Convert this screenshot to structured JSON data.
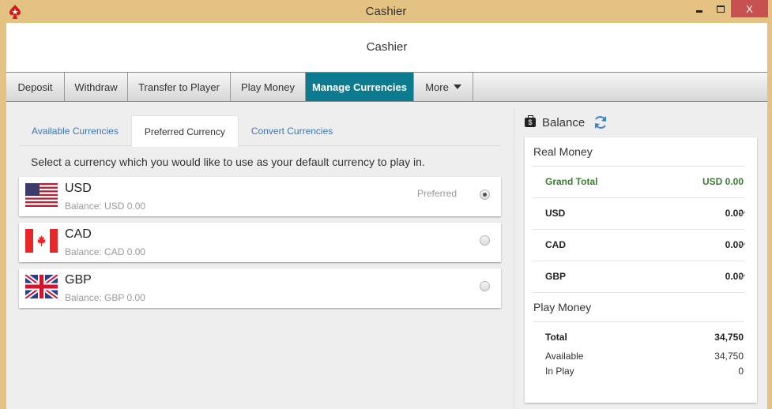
{
  "window": {
    "title": "Cashier",
    "close_label": "X"
  },
  "header": {
    "title": "Cashier"
  },
  "nav": {
    "items": [
      {
        "label": "Deposit"
      },
      {
        "label": "Withdraw"
      },
      {
        "label": "Transfer to Player"
      },
      {
        "label": "Play Money"
      },
      {
        "label": "Manage Currencies",
        "active": true
      },
      {
        "label": "More"
      }
    ],
    "accent_color": "#0c7b8f"
  },
  "subtabs": {
    "items": [
      {
        "label": "Available Currencies"
      },
      {
        "label": "Preferred Currency",
        "active": true
      },
      {
        "label": "Convert Currencies"
      }
    ]
  },
  "instruction": "Select a currency which you would like to use as your default currency to play in.",
  "currencies": [
    {
      "code": "USD",
      "balance": "Balance: USD 0.00",
      "flag": "us-flag-icon",
      "preferred_label": "Preferred",
      "selected": true
    },
    {
      "code": "CAD",
      "balance": "Balance: CAD 0.00",
      "flag": "canada-flag-icon",
      "selected": false
    },
    {
      "code": "GBP",
      "balance": "Balance: GBP 0.00",
      "flag": "uk-flag-icon",
      "selected": false
    }
  ],
  "balance": {
    "title": "Balance",
    "real_money": {
      "title": "Real Money",
      "grand_total_label": "Grand Total",
      "grand_total_value": "USD 0.00",
      "grand_total_color": "#3c7a35",
      "rows": [
        {
          "label": "USD",
          "value": "0.00"
        },
        {
          "label": "CAD",
          "value": "0.00"
        },
        {
          "label": "GBP",
          "value": "0.00"
        }
      ]
    },
    "play_money": {
      "title": "Play Money",
      "total_label": "Total",
      "total_value": "34,750",
      "available_label": "Available",
      "available_value": "34,750",
      "in_play_label": "In Play",
      "in_play_value": "0"
    }
  }
}
